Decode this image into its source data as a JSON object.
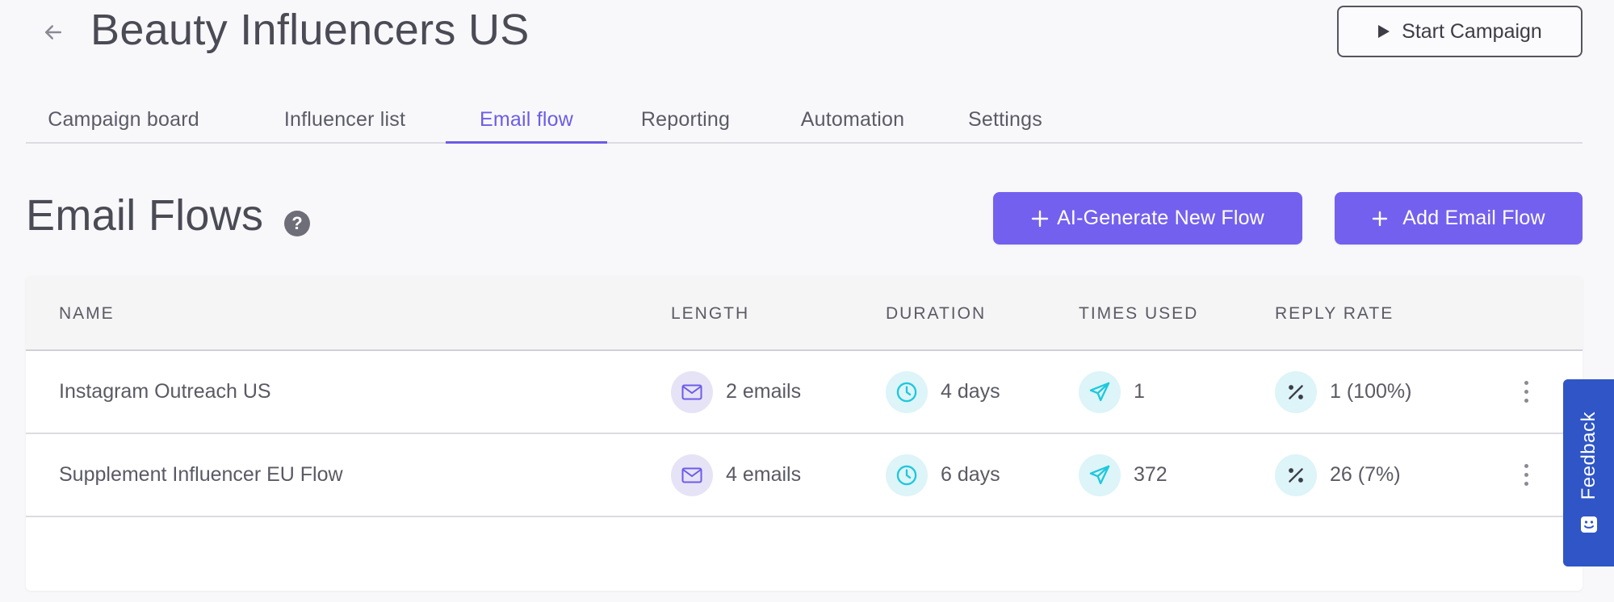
{
  "header": {
    "title": "Beauty Influencers US",
    "start_label": "Start Campaign"
  },
  "tabs": [
    {
      "label": "Campaign board",
      "active": false
    },
    {
      "label": "Influencer list",
      "active": false
    },
    {
      "label": "Email flow",
      "active": true
    },
    {
      "label": "Reporting",
      "active": false
    },
    {
      "label": "Automation",
      "active": false
    },
    {
      "label": "Settings",
      "active": false
    }
  ],
  "section": {
    "title": "Email Flows",
    "help": "?",
    "ai_generate_label": "AI-Generate New Flow",
    "add_label": "Add Email Flow"
  },
  "table": {
    "columns": [
      "NAME",
      "LENGTH",
      "DURATION",
      "TIMES USED",
      "REPLY RATE"
    ],
    "rows": [
      {
        "name": "Instagram Outreach US",
        "length": "2 emails",
        "duration": "4 days",
        "times_used": "1",
        "reply_rate": "1 (100%)"
      },
      {
        "name": "Supplement Influencer EU Flow",
        "length": "4 emails",
        "duration": "6 days",
        "times_used": "372",
        "reply_rate": "26 (7%)"
      }
    ]
  },
  "feedback": {
    "label": "Feedback"
  },
  "colors": {
    "accent": "#7360ef",
    "active_tab": "#6c5ce7",
    "icon_purple_bg": "#e6e3f7",
    "icon_cyan_bg": "#ddf4f8",
    "icon_cyan": "#1ec8dc",
    "feedback_bg": "#2f55c6"
  }
}
